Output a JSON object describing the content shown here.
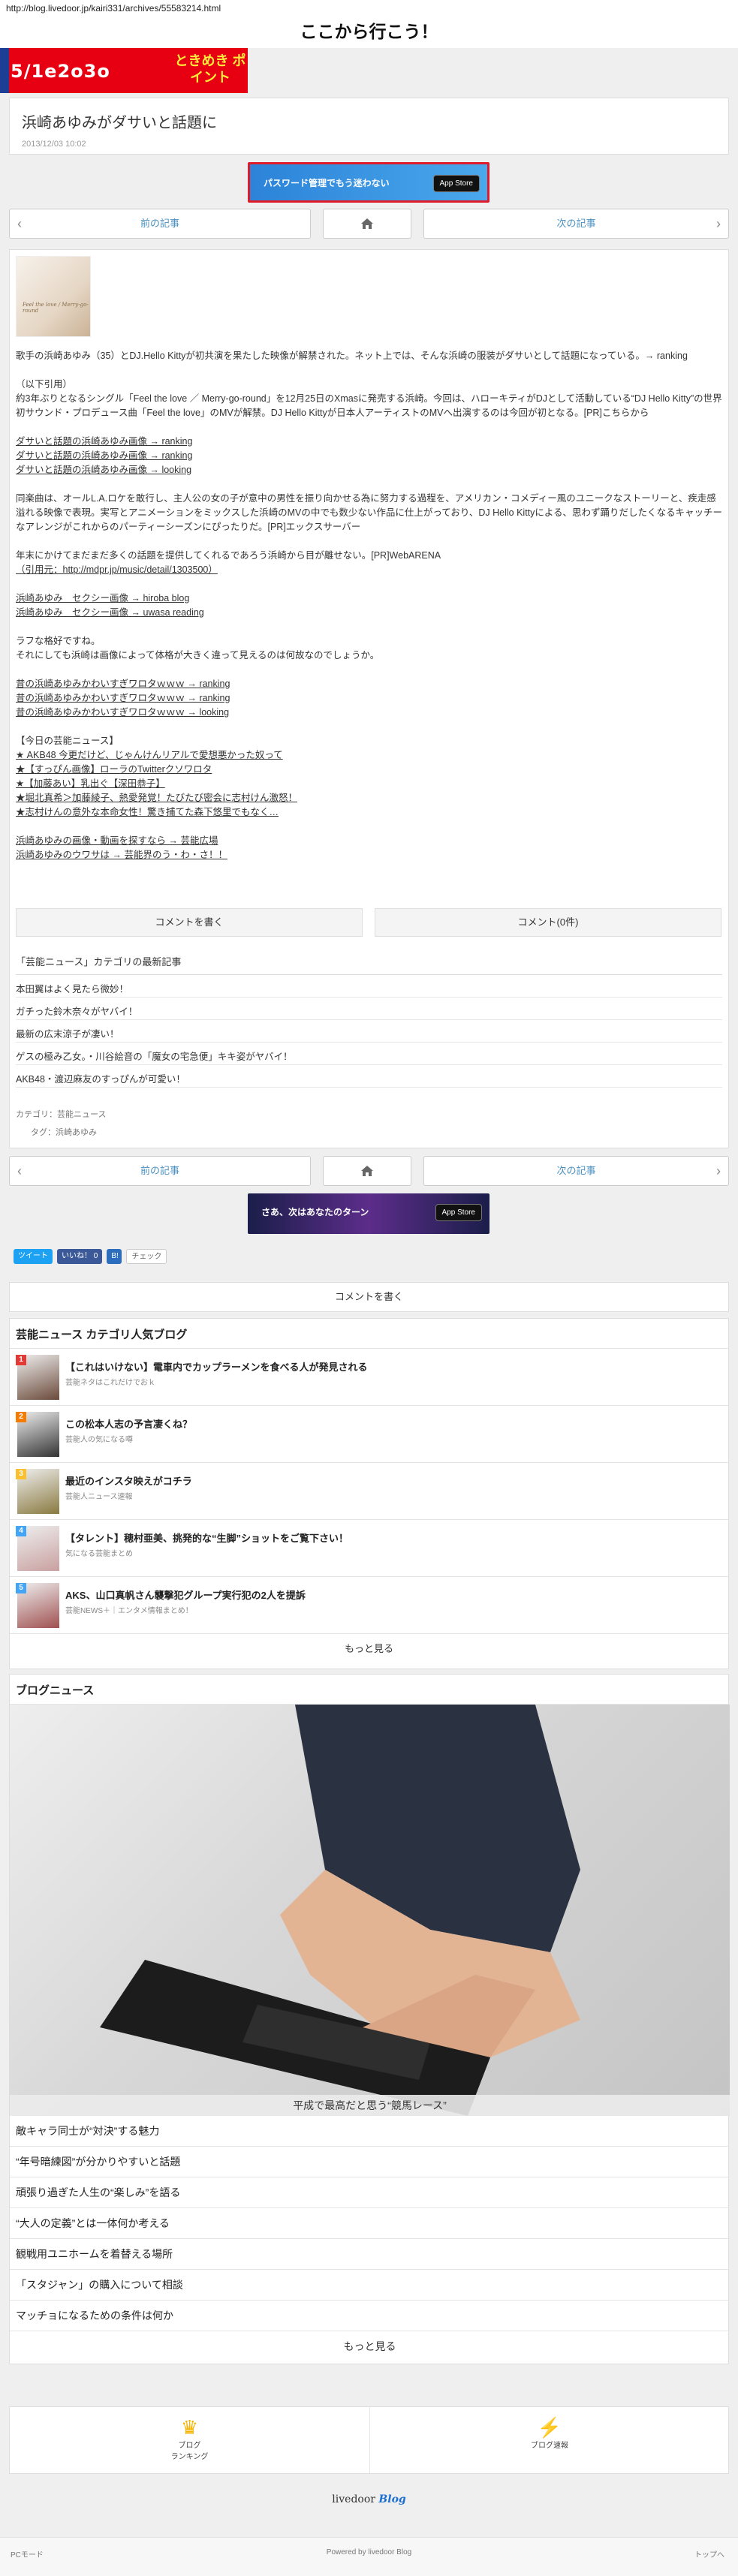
{
  "url": "http://blog.livedoor.jp/kairi331/archives/55583214.html",
  "blog_title": "ここから行こう！",
  "top_banner": {
    "left": "5/1e2o3o",
    "right": "ときめき\nポイント"
  },
  "article": {
    "title": "浜崎あゆみがダサいと話題に",
    "date": "2013/12/03 10:02",
    "thumb_caption": "Feel the love / Merry-go-round"
  },
  "ad1": {
    "text": "パスワード管理でもう迷わない",
    "store": "App Store"
  },
  "ad2": {
    "text": "さあ、次はあなたのターン",
    "store": "App Store"
  },
  "nav": {
    "prev": "前の記事",
    "next": "次の記事"
  },
  "body": {
    "p1": "歌手の浜崎あゆみ（35）とDJ.Hello Kittyが初共演を果たした映像が解禁された。ネット上では、そんな浜崎の服装がダサいとして話題になっている。→ ranking",
    "p2a": "（以下引用）",
    "p2b": "約3年ぶりとなるシングル「Feel the love ／ Merry-go-round」を12月25日のXmasに発売する浜崎。今回は、ハローキティがDJとして活動している“DJ Hello Kitty”の世界初サウンド・プロデュース曲「Feel the love」のMVが解禁。DJ Hello Kittyが日本人アーティストのMVへ出演するのは今回が初となる。[PR]こちらから",
    "p3a": "ダサいと話題の浜崎あゆみ画像 → ranking",
    "p3b": "ダサいと話題の浜崎あゆみ画像 → ranking",
    "p3c": "ダサいと話題の浜崎あゆみ画像 → looking",
    "p4": "同楽曲は、オールL.A.ロケを敢行し、主人公の女の子が意中の男性を振り向かせる為に努力する過程を、アメリカン・コメディー風のユニークなストーリーと、疾走感溢れる映像で表現。実写とアニメーションをミックスした浜崎のMVの中でも数少ない作品に仕上がっており、DJ Hello Kittyによる、思わず踊りだしたくなるキャッチーなアレンジがこれからのパーティーシーズンにぴったりだ。[PR]エックスサーバー",
    "p5a": "年末にかけてまだまだ多くの話題を提供してくれるであろう浜崎から目が離せない。[PR]WebARENA",
    "p5b": "（引用元：http://mdpr.jp/music/detail/1303500）",
    "p6a": "浜崎あゆみ　セクシー画像 → hiroba blog",
    "p6b": "浜崎あゆみ　セクシー画像 → uwasa reading",
    "p7a": "ラフな格好ですね。",
    "p7b": "それにしても浜崎は画像によって体格が大きく違って見えるのは何故なのでしょうか。",
    "p8a": "昔の浜崎あゆみかわいすぎワロタｗｗｗ → ranking",
    "p8b": "昔の浜崎あゆみかわいすぎワロタｗｗｗ → ranking",
    "p8c": "昔の浜崎あゆみかわいすぎワロタｗｗｗ → looking",
    "p9h": "【今日の芸能ニュース】",
    "p9a": "★ AKB48 今更だけど、じゃんけんリアルで愛想悪かった奴って",
    "p9b": "★【すっぴん画像】ローラのTwitterクソワロタ",
    "p9c": "★【加藤あい】乳出ぐ【深田恭子】",
    "p9d": "★堀北真希＞加藤綾子、熱愛発覚！たびたび密会に志村けん激怒！",
    "p9e": "★志村けんの意外な本命女性！驚き捕てた森下悠里でもなく…",
    "p10a": "浜崎あゆみの画像・動画を探すなら → 芸能広場",
    "p10b": "浜崎あゆみのウワサは → 芸能界のう・わ・さ！！"
  },
  "comment": {
    "write": "コメントを書く",
    "count": "コメント(0件)"
  },
  "related": {
    "heading": "「芸能ニュース」カテゴリの最新記事",
    "items": [
      "本田翼はよく見たら微妙！",
      "ガチった鈴木奈々がヤバイ！",
      "最新の広末涼子が凄い！",
      "ゲスの極み乙女。・川谷絵音の「魔女の宅急便」キキ姿がヤバイ！",
      "AKB48・渡辺麻友のすっぴんが可愛い！"
    ]
  },
  "meta": {
    "category_label": "カテゴリ：",
    "category": "芸能ニュース",
    "tag_label": "タグ：",
    "tag": "浜崎あゆみ"
  },
  "share": {
    "tweet": "ツイート",
    "like": "いいね！ 0",
    "hatena": "B!",
    "mixi": "チェック"
  },
  "comment_bar": "コメントを書く",
  "popular": {
    "heading": "芸能ニュース カテゴリ人気ブログ",
    "items": [
      {
        "rank": "1",
        "title": "【これはいけない】電車内でカップラーメンを食べる人が発見される",
        "sub": "芸能ネタはこれだけでおｋ",
        "color": "#e53935"
      },
      {
        "rank": "2",
        "title": "この松本人志の予言凄くね？",
        "sub": "芸能人の気になる噂",
        "color": "#f57c00"
      },
      {
        "rank": "3",
        "title": "最近のインスタ映えがコチラ",
        "sub": "芸能人ニュース速報",
        "color": "#fbc02d"
      },
      {
        "rank": "4",
        "title": "【タレント】穂村亜美、挑発的な“生脚”ショットをご覧下さい！",
        "sub": "気になる芸能まとめ",
        "color": "#42a5f5"
      },
      {
        "rank": "5",
        "title": "AKS、山口真帆さん襲撃犯グループ実行犯の2人を提訴",
        "sub": "芸能NEWS＋｜エンタメ情報まとめ！",
        "color": "#42a5f5"
      }
    ],
    "more": "もっと見る"
  },
  "news": {
    "heading": "ブログニュース",
    "caption": "平成で最高だと思う“競馬レース”",
    "items": [
      "敵キャラ同士が“対決”する魅力",
      "“年号暗練図”が分かりやすいと話題",
      "頑張り過ぎた人生の“楽しみ”を語る",
      "“大人の定義”とは一体何か考える",
      "観戦用ユニホームを着替える場所",
      "「スタジャン」の購入について相談",
      "マッチョになるための条件は何か"
    ],
    "more": "もっと見る"
  },
  "bottom_nav": {
    "ranking": "ブログ\nランキング",
    "fast": "ブログ速報"
  },
  "footer_logo": {
    "brand": "livedoor",
    "blog": "Blog"
  },
  "footer": {
    "pc": "PCモード",
    "powered": "Powered by livedoor Blog",
    "top": "トップへ"
  }
}
